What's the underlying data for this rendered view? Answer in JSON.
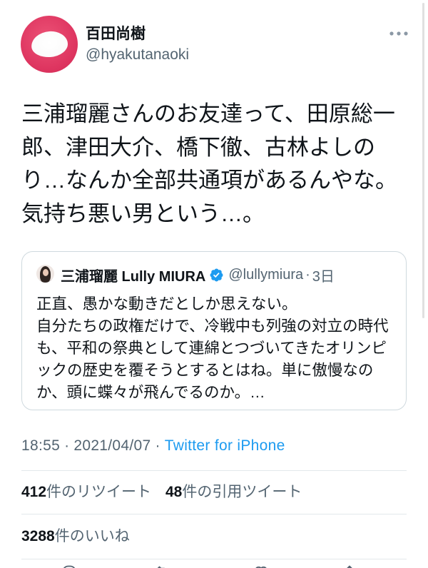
{
  "tweet": {
    "author": {
      "name": "百田尚樹",
      "handle": "@hyakutanaoki"
    },
    "text_lines": [
      "三浦瑠麗さんのお友達って、田原総一",
      "郎、津田大介、橋下徹、古林よしの",
      "り…なんか全部共通項があるんやな。",
      "気持ち悪い男という…。"
    ],
    "quoted_tweet": {
      "author_name": "三浦瑠麗 Lully MIURA",
      "verified": true,
      "handle": "@lullymiura",
      "separator": "·",
      "time_ago": "3日",
      "text_lines": [
        "正直、愚かな動きだとしか思えない。",
        "自分たちの政権だけで、冷戦中も列強の対立の時代",
        "も、平和の祭典として連綿とつづいてきたオリンピ",
        "ックの歴史を覆そうとするとはね。単に傲慢なの",
        "か、頭に蝶々が飛んでるのか。…"
      ]
    },
    "meta": {
      "time": "18:55",
      "separator": "·",
      "date": "2021/04/07",
      "source": "Twitter for iPhone"
    },
    "stats": {
      "retweets": {
        "count": "412",
        "label": "件のリツイート"
      },
      "quote_tweets": {
        "count": "48",
        "label": "件の引用ツイート"
      },
      "likes": {
        "count": "3288",
        "label": "件のいいね"
      }
    }
  },
  "icons": {
    "more": "more-dots-icon",
    "verified": "verified-badge-icon",
    "actions": [
      "reply-icon",
      "retweet-icon",
      "like-icon",
      "share-icon"
    ]
  },
  "colors": {
    "text": "#0f1419",
    "secondary_text": "#536471",
    "link": "#1d9bf0",
    "verified_badge": "#1d9bf0",
    "divider": "#e3e8eb",
    "avatar_background": "#de3560"
  }
}
